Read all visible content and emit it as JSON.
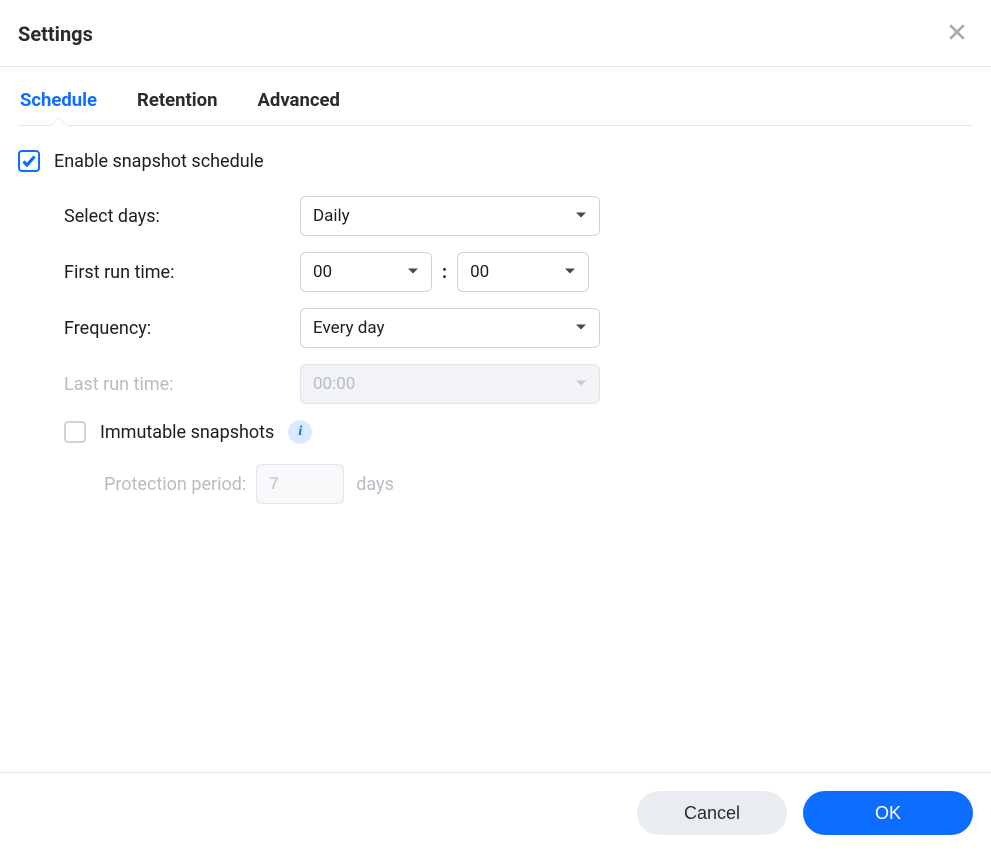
{
  "header": {
    "title": "Settings"
  },
  "tabs": [
    {
      "id": "schedule",
      "label": "Schedule",
      "active": true
    },
    {
      "id": "retention",
      "label": "Retention",
      "active": false
    },
    {
      "id": "advanced",
      "label": "Advanced",
      "active": false
    }
  ],
  "schedule": {
    "enable_checkbox_checked": true,
    "enable_label": "Enable snapshot schedule",
    "select_days_label": "Select days:",
    "select_days_value": "Daily",
    "first_run_label": "First run time:",
    "first_run_hour": "00",
    "first_run_minute": "00",
    "time_separator": ":",
    "frequency_label": "Frequency:",
    "frequency_value": "Every day",
    "last_run_label": "Last run time:",
    "last_run_value": "00:00",
    "last_run_disabled": true,
    "immutable_checked": false,
    "immutable_label": "Immutable snapshots",
    "protection_label": "Protection period:",
    "protection_value": "7",
    "protection_unit": "days",
    "protection_disabled": true
  },
  "footer": {
    "cancel": "Cancel",
    "ok": "OK"
  },
  "colors": {
    "accent": "#0d6dff",
    "border": "#e6e6e6",
    "text": "#1e1e1e",
    "muted": "#b7bcc3"
  }
}
